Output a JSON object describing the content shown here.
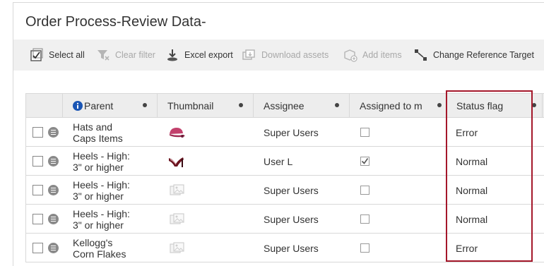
{
  "page": {
    "title": "Order Process-Review Data-"
  },
  "toolbar": {
    "select_all": "Select all",
    "clear_filter": "Clear filter",
    "excel_export": "Excel export",
    "download_assets": "Download assets",
    "add_items": "Add items",
    "change_reference_target": "Change Reference Target"
  },
  "grid": {
    "columns": {
      "parent": "Parent",
      "thumbnail": "Thumbnail",
      "assignee": "Assignee",
      "assigned_to_me": "Assigned to m",
      "status_flag": "Status flag"
    },
    "rows": [
      {
        "parent_line1": "Hats and",
        "parent_line2": "Caps Items",
        "thumbnail": "cap-icon",
        "assignee": "Super Users",
        "assigned": false,
        "status": "Error"
      },
      {
        "parent_line1": "Heels - High:",
        "parent_line2": "3\" or higher",
        "thumbnail": "heel-shoe-icon",
        "assignee": "User L",
        "assigned": true,
        "status": "Normal"
      },
      {
        "parent_line1": "Heels - High:",
        "parent_line2": "3\" or higher",
        "thumbnail": "placeholder-image-icon",
        "assignee": "Super Users",
        "assigned": false,
        "status": "Normal"
      },
      {
        "parent_line1": "Heels - High:",
        "parent_line2": "3\" or higher",
        "thumbnail": "placeholder-image-icon",
        "assignee": "Super Users",
        "assigned": false,
        "status": "Normal"
      },
      {
        "parent_line1": "Kellogg's",
        "parent_line2": "Corn Flakes",
        "thumbnail": "placeholder-image-icon",
        "assignee": "Super Users",
        "assigned": false,
        "status": "Error"
      }
    ]
  },
  "colors": {
    "highlight": "#a4172a",
    "info_icon": "#1a55b4",
    "toolbar_bg": "#f0f0f0",
    "header_bg": "#ededed"
  }
}
